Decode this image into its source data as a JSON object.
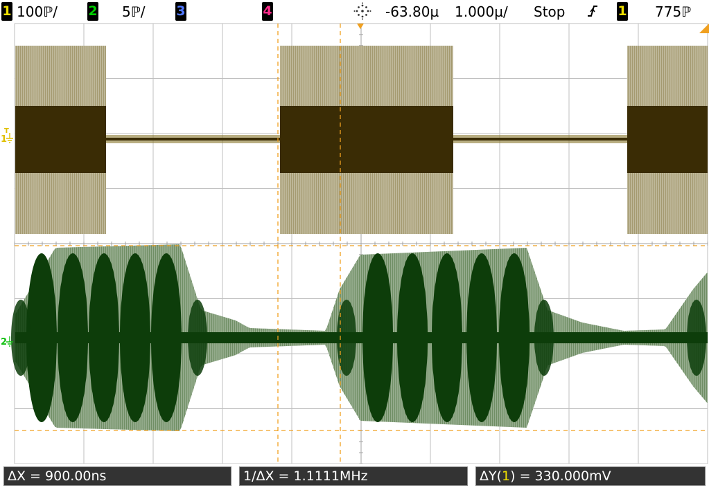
{
  "status_bar": {
    "ch1": {
      "number": "1",
      "scale": "100ℙ/",
      "color": "#f0e000"
    },
    "ch2": {
      "number": "2",
      "scale": "5ℙ/",
      "color": "#00d000"
    },
    "ch3": {
      "number": "3",
      "color": "#5078ff"
    },
    "ch4": {
      "number": "4",
      "color": "#ff2a8a"
    },
    "trigger_icon": "agilent-spark-icon",
    "delay": "-63.80µ",
    "timebase": "1.000µ/",
    "run_state": "Stop",
    "trigger_slope_icon": "rising-edge-icon",
    "trigger_source": "1",
    "trigger_level": "775ℙ"
  },
  "measurements": {
    "delta_x": "ΔX = 900.00ns",
    "inverse_delta_x": "1/ΔX = 1.1111MHz",
    "delta_y_prefix": "ΔY(",
    "delta_y_source": "1",
    "delta_y_suffix": ") = 330.000mV"
  },
  "channel_markers": {
    "ch1": "1",
    "ch2": "2",
    "trigger": "T"
  },
  "colors": {
    "ch1_trace": "#3a2c05",
    "ch1_fringe": "#a49a70",
    "ch2_trace": "#0d3d0a",
    "ch2_fringe": "#6f8e64",
    "graticule": "#bfbfbf",
    "cursor": "#f0a020"
  }
}
